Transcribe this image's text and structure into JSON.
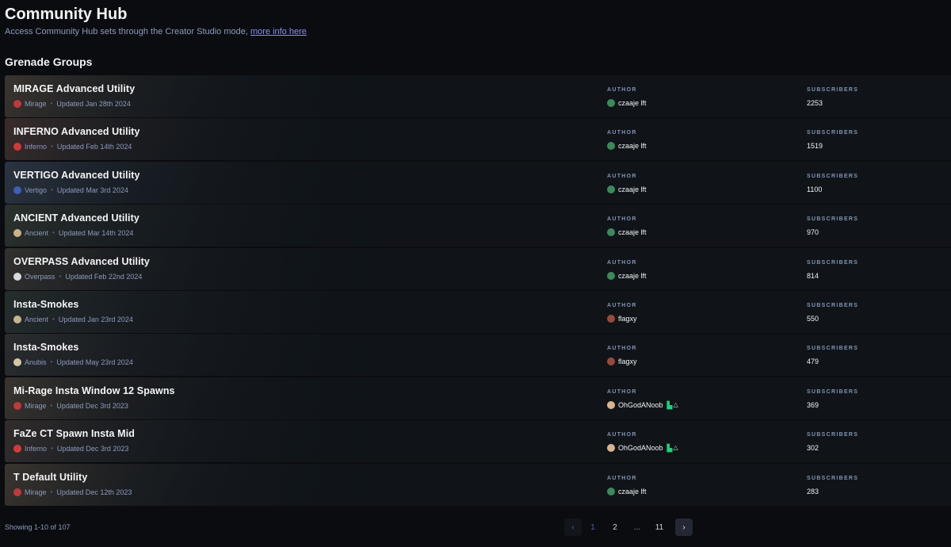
{
  "header": {
    "title": "Community Hub",
    "subtitle": "Access Community Hub sets through the Creator Studio mode, ",
    "link_text": "more info here",
    "section_title": "Grenade Groups"
  },
  "columns": {
    "author_label": "AUTHOR",
    "subscribers_label": "SUBSCRIBERS"
  },
  "rows": [
    {
      "name": "MIRAGE Advanced Utility",
      "map": "Mirage",
      "map_icon": "mirage-icon",
      "map_color": "#c0393b",
      "bg": "#6a5a48",
      "updated": "Updated Jan 28th 2024",
      "author": "czaaje lft",
      "avatar_color": "#3c8a5a",
      "badge": false,
      "subscribers": "2253"
    },
    {
      "name": "INFERNO Advanced Utility",
      "map": "Inferno",
      "map_icon": "inferno-icon",
      "map_color": "#d23a3a",
      "bg": "#6b4a42",
      "updated": "Updated Feb 14th 2024",
      "author": "czaaje lft",
      "avatar_color": "#3c8a5a",
      "badge": false,
      "subscribers": "1519"
    },
    {
      "name": "VERTIGO Advanced Utility",
      "map": "Vertigo",
      "map_icon": "vertigo-icon",
      "map_color": "#3c5fb8",
      "bg": "#4a5a70",
      "updated": "Updated Mar 3rd 2024",
      "author": "czaaje lft",
      "avatar_color": "#3c8a5a",
      "badge": false,
      "subscribers": "1100"
    },
    {
      "name": "ANCIENT Advanced Utility",
      "map": "Ancient",
      "map_icon": "ancient-icon",
      "map_color": "#c9b48a",
      "bg": "#4a5545",
      "updated": "Updated Mar 14th 2024",
      "author": "czaaje lft",
      "avatar_color": "#3c8a5a",
      "badge": false,
      "subscribers": "970"
    },
    {
      "name": "OVERPASS Advanced Utility",
      "map": "Overpass",
      "map_icon": "overpass-icon",
      "map_color": "#d8dadc",
      "bg": "#5a5248",
      "updated": "Updated Feb 22nd 2024",
      "author": "czaaje lft",
      "avatar_color": "#3c8a5a",
      "badge": false,
      "subscribers": "814"
    },
    {
      "name": "Insta-Smokes",
      "map": "Ancient",
      "map_icon": "ancient-icon",
      "map_color": "#c9b48a",
      "bg": "#3e4a44",
      "updated": "Updated Jan 23rd 2024",
      "author": "flagxy",
      "avatar_color": "#9a4a3a",
      "badge": false,
      "subscribers": "550"
    },
    {
      "name": "Insta-Smokes",
      "map": "Anubis",
      "map_icon": "anubis-icon",
      "map_color": "#d6c7a4",
      "bg": "#4a4a48",
      "updated": "Updated May 23rd 2024",
      "author": "flagxy",
      "avatar_color": "#9a4a3a",
      "badge": false,
      "subscribers": "479"
    },
    {
      "name": "Mi-Rage Insta Window 12 Spawns",
      "map": "Mirage",
      "map_icon": "mirage-icon",
      "map_color": "#c0393b",
      "bg": "#6a5a48",
      "updated": "Updated Dec 3rd 2023",
      "author": "OhGodANoob",
      "avatar_color": "#d9b48a",
      "badge": true,
      "subscribers": "369"
    },
    {
      "name": "FaZe CT Spawn Insta Mid",
      "map": "Inferno",
      "map_icon": "inferno-icon",
      "map_color": "#d23a3a",
      "bg": "#5a4a44",
      "updated": "Updated Dec 3rd 2023",
      "author": "OhGodANoob",
      "avatar_color": "#d9b48a",
      "badge": true,
      "subscribers": "302"
    },
    {
      "name": "T Default Utility",
      "map": "Mirage",
      "map_icon": "mirage-icon",
      "map_color": "#c0393b",
      "bg": "#6a5a48",
      "updated": "Updated Dec 12th 2023",
      "author": "czaaje lft",
      "avatar_color": "#3c8a5a",
      "badge": false,
      "subscribers": "283"
    }
  ],
  "footer": {
    "showing": "Showing 1-10 of 107",
    "pages": [
      "1",
      "2",
      "...",
      "11"
    ],
    "current_page": "1",
    "prev_icon": "‹",
    "next_icon": "›"
  }
}
